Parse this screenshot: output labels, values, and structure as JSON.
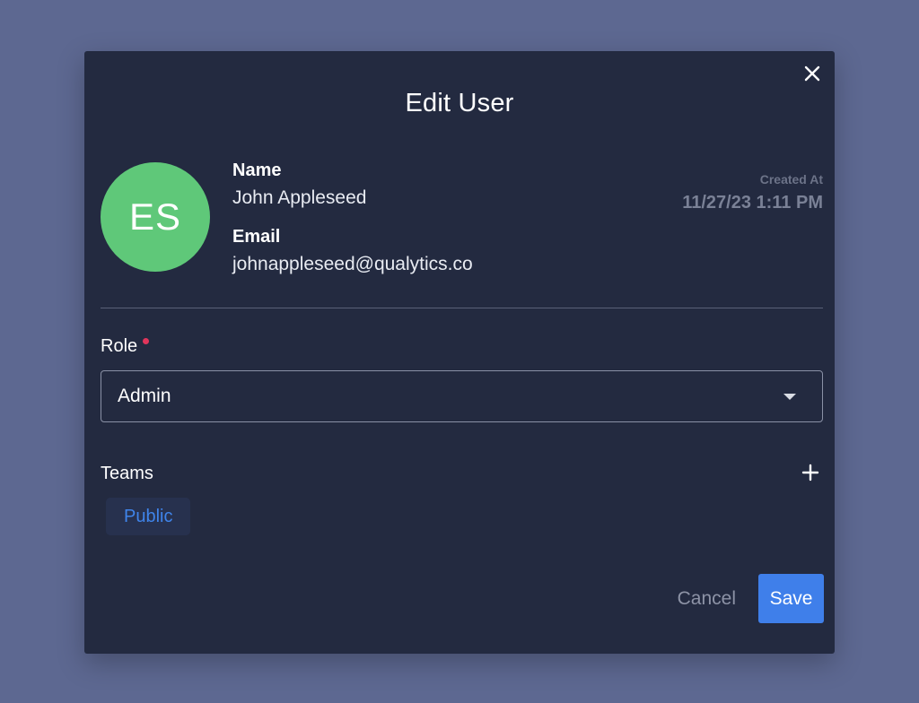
{
  "modal": {
    "title": "Edit User",
    "close_icon": "close-icon"
  },
  "user": {
    "initials": "ES",
    "avatar_color": "#5fc879",
    "name_label": "Name",
    "name": "John Appleseed",
    "email_label": "Email",
    "email": "johnappleseed@qualytics.co",
    "created_label": "Created At",
    "created_value": "11/27/23 1:11 PM"
  },
  "role": {
    "label": "Role",
    "required": true,
    "selected": "Admin",
    "icon": "chevron-down-icon"
  },
  "teams": {
    "label": "Teams",
    "add_icon": "plus-icon",
    "items": [
      "Public"
    ]
  },
  "actions": {
    "cancel_label": "Cancel",
    "save_label": "Save"
  },
  "colors": {
    "background": "#5d6891",
    "modal": "#232a40",
    "accent": "#3f7fea",
    "chip_text": "#3f84ea",
    "required": "#e0355b"
  }
}
